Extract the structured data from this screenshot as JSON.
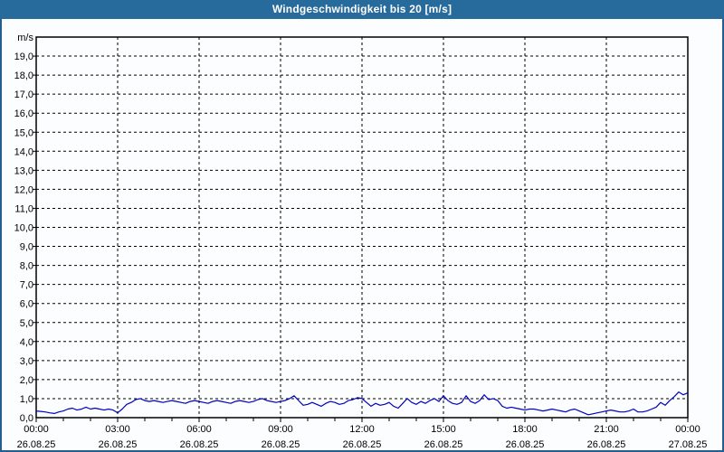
{
  "title": "Windgeschwindigkeit bis 20 [m/s]",
  "colors": {
    "titlebar": "#276a9c",
    "page_border": "#235e8e",
    "background": "#fbfdfe",
    "plot_border": "#000000",
    "grid": "#000000",
    "line": "#0000bf",
    "text": "#000000"
  },
  "chart_data": {
    "type": "line",
    "title": "Windgeschwindigkeit bis 20 [m/s]",
    "ylabel": "m/s",
    "xlabel": "",
    "ylim": [
      0,
      20
    ],
    "ytick_step": 1.0,
    "ytick_labels": [
      "0,0",
      "1,0",
      "2,0",
      "3,0",
      "4,0",
      "5,0",
      "6,0",
      "7,0",
      "8,0",
      "9,0",
      "10,0",
      "11,0",
      "12,0",
      "13,0",
      "14,0",
      "15,0",
      "16,0",
      "17,0",
      "18,0",
      "19,0"
    ],
    "grid": "dashed",
    "legend": "none",
    "x_axis": {
      "span_hours": 24,
      "major_tick_hours": 3,
      "minor_tick_hours": 1,
      "labels": [
        {
          "time": "00:00",
          "date": "26.08.25"
        },
        {
          "time": "03:00",
          "date": "26.08.25"
        },
        {
          "time": "06:00",
          "date": "26.08.25"
        },
        {
          "time": "09:00",
          "date": "26.08.25"
        },
        {
          "time": "12:00",
          "date": "26.08.25"
        },
        {
          "time": "15:00",
          "date": "26.08.25"
        },
        {
          "time": "18:00",
          "date": "26.08.25"
        },
        {
          "time": "21:00",
          "date": "26.08.25"
        },
        {
          "time": "00:00",
          "date": "27.08.25"
        }
      ]
    },
    "series": [
      {
        "name": "Windgeschwindigkeit",
        "unit": "m/s",
        "start": "26.08.25 00:00",
        "sample_interval_minutes": 10,
        "values": [
          0.35,
          0.33,
          0.3,
          0.25,
          0.22,
          0.3,
          0.35,
          0.45,
          0.5,
          0.4,
          0.45,
          0.55,
          0.45,
          0.5,
          0.45,
          0.4,
          0.45,
          0.4,
          0.25,
          0.45,
          0.7,
          0.8,
          0.95,
          1.0,
          0.9,
          0.85,
          0.9,
          0.85,
          0.8,
          0.85,
          0.9,
          0.85,
          0.8,
          0.75,
          0.85,
          0.9,
          0.85,
          0.8,
          0.75,
          0.85,
          0.9,
          0.85,
          0.8,
          0.75,
          0.85,
          0.9,
          0.85,
          0.8,
          0.85,
          0.95,
          1.0,
          0.9,
          0.85,
          0.8,
          0.85,
          0.9,
          1.0,
          1.15,
          0.9,
          0.65,
          0.7,
          0.8,
          0.7,
          0.6,
          0.75,
          0.85,
          0.8,
          0.7,
          0.75,
          0.9,
          0.95,
          1.05,
          1.0,
          0.8,
          0.6,
          0.75,
          0.65,
          0.7,
          0.8,
          0.6,
          0.5,
          0.75,
          1.0,
          0.8,
          0.7,
          0.85,
          0.75,
          0.9,
          1.0,
          0.85,
          1.15,
          0.9,
          0.75,
          0.7,
          0.8,
          1.15,
          0.85,
          0.75,
          0.9,
          1.2,
          0.95,
          1.0,
          0.9,
          0.6,
          0.5,
          0.55,
          0.5,
          0.45,
          0.4,
          0.45,
          0.45,
          0.4,
          0.35,
          0.4,
          0.45,
          0.4,
          0.35,
          0.3,
          0.4,
          0.45,
          0.35,
          0.25,
          0.15,
          0.2,
          0.25,
          0.3,
          0.35,
          0.4,
          0.35,
          0.3,
          0.3,
          0.35,
          0.45,
          0.3,
          0.3,
          0.35,
          0.45,
          0.55,
          0.8,
          0.65,
          0.9,
          1.1,
          1.35,
          1.2,
          1.3
        ]
      }
    ]
  }
}
